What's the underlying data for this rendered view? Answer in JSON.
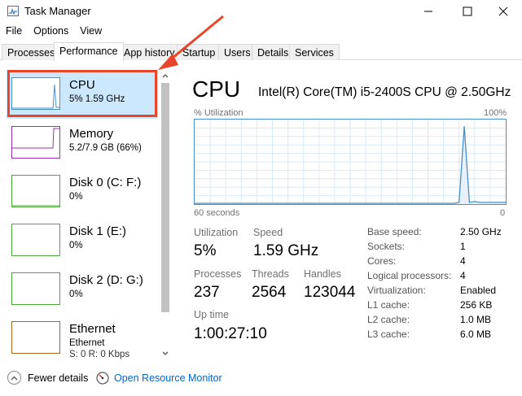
{
  "window": {
    "title": "Task Manager"
  },
  "menu": [
    "File",
    "Options",
    "View"
  ],
  "tabs": [
    "Processes",
    "Performance",
    "App history",
    "Startup",
    "Users",
    "Details",
    "Services"
  ],
  "active_tab": "Performance",
  "sidebar": {
    "items": [
      {
        "name": "CPU",
        "sub1": "5%  1.59 GHz",
        "sub2": "",
        "color": "#4a90c8",
        "selected": true
      },
      {
        "name": "Memory",
        "sub1": "5.2/7.9 GB (66%)",
        "sub2": "",
        "color": "#9a2db0",
        "selected": false
      },
      {
        "name": "Disk 0 (C: F:)",
        "sub1": "0%",
        "sub2": "",
        "color": "#4caa3a",
        "selected": false
      },
      {
        "name": "Disk 1 (E:)",
        "sub1": "0%",
        "sub2": "",
        "color": "#4caa3a",
        "selected": false
      },
      {
        "name": "Disk 2 (D: G:)",
        "sub1": "0%",
        "sub2": "",
        "color": "#4caa3a",
        "selected": false
      },
      {
        "name": "Ethernet",
        "sub1": "Ethernet",
        "sub2": "S: 0 R: 0 Kbps",
        "color": "#a8651a",
        "selected": false
      }
    ]
  },
  "main": {
    "title": "CPU",
    "model": "Intel(R) Core(TM) i5-2400S CPU @ 2.50GHz",
    "graph": {
      "y_label": "% Utilization",
      "y_max_label": "100%",
      "x_left_label": "60 seconds",
      "x_right_label": "0",
      "utilization_series": [
        1,
        1,
        1,
        1,
        1,
        1,
        1,
        1,
        1,
        1,
        1,
        1,
        1,
        1,
        1,
        1,
        1,
        1,
        1,
        1,
        1,
        1,
        1,
        1,
        1,
        1,
        1,
        1,
        1,
        1,
        1,
        1,
        1,
        1,
        1,
        1,
        1,
        1,
        1,
        1,
        1,
        1,
        1,
        1,
        1,
        1,
        1,
        1,
        1,
        1,
        1,
        2,
        92,
        2,
        3,
        2,
        2,
        2,
        2,
        2,
        2
      ]
    },
    "stats": {
      "utilization_label": "Utilization",
      "utilization_value": "5%",
      "speed_label": "Speed",
      "speed_value": "1.59 GHz",
      "processes_label": "Processes",
      "processes_value": "237",
      "threads_label": "Threads",
      "threads_value": "2564",
      "handles_label": "Handles",
      "handles_value": "123044",
      "uptime_label": "Up time",
      "uptime_value": "1:00:27:10"
    },
    "details": [
      {
        "label": "Base speed:",
        "value": "2.50 GHz"
      },
      {
        "label": "Sockets:",
        "value": "1"
      },
      {
        "label": "Cores:",
        "value": "4"
      },
      {
        "label": "Logical processors:",
        "value": "4"
      },
      {
        "label": "Virtualization:",
        "value": "Enabled"
      },
      {
        "label": "L1 cache:",
        "value": "256 KB"
      },
      {
        "label": "L2 cache:",
        "value": "1.0 MB"
      },
      {
        "label": "L3 cache:",
        "value": "6.0 MB"
      }
    ]
  },
  "footer": {
    "fewer_details": "Fewer details",
    "open_resource_monitor": "Open Resource Monitor"
  },
  "colors": {
    "accent": "#4a90c8",
    "highlight": "#e8462a",
    "selection": "#cce8ff",
    "link": "#0066cc"
  }
}
